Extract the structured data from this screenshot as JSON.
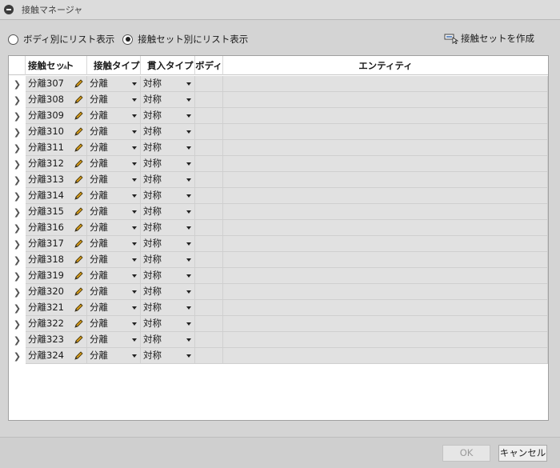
{
  "window": {
    "title": "接触マネージャ"
  },
  "mode": {
    "options": [
      {
        "label": "ボディ別にリスト表示",
        "checked": false
      },
      {
        "label": "接触セット別にリスト表示",
        "checked": true
      }
    ],
    "create_set_label": "接触セットを作成"
  },
  "grid": {
    "columns": [
      "接触セット",
      "接触タイプ",
      "貫入タイプ",
      "ボディ",
      "エンティティ"
    ],
    "rows": [
      {
        "name": "分離307",
        "contact_type": "分離",
        "penetration_type": "対称",
        "body": "",
        "entity": ""
      },
      {
        "name": "分離308",
        "contact_type": "分離",
        "penetration_type": "対称",
        "body": "",
        "entity": ""
      },
      {
        "name": "分離309",
        "contact_type": "分離",
        "penetration_type": "対称",
        "body": "",
        "entity": ""
      },
      {
        "name": "分離310",
        "contact_type": "分離",
        "penetration_type": "対称",
        "body": "",
        "entity": ""
      },
      {
        "name": "分離311",
        "contact_type": "分離",
        "penetration_type": "対称",
        "body": "",
        "entity": ""
      },
      {
        "name": "分離312",
        "contact_type": "分離",
        "penetration_type": "対称",
        "body": "",
        "entity": ""
      },
      {
        "name": "分離313",
        "contact_type": "分離",
        "penetration_type": "対称",
        "body": "",
        "entity": ""
      },
      {
        "name": "分離314",
        "contact_type": "分離",
        "penetration_type": "対称",
        "body": "",
        "entity": ""
      },
      {
        "name": "分離315",
        "contact_type": "分離",
        "penetration_type": "対称",
        "body": "",
        "entity": ""
      },
      {
        "name": "分離316",
        "contact_type": "分離",
        "penetration_type": "対称",
        "body": "",
        "entity": ""
      },
      {
        "name": "分離317",
        "contact_type": "分離",
        "penetration_type": "対称",
        "body": "",
        "entity": ""
      },
      {
        "name": "分離318",
        "contact_type": "分離",
        "penetration_type": "対称",
        "body": "",
        "entity": ""
      },
      {
        "name": "分離319",
        "contact_type": "分離",
        "penetration_type": "対称",
        "body": "",
        "entity": ""
      },
      {
        "name": "分離320",
        "contact_type": "分離",
        "penetration_type": "対称",
        "body": "",
        "entity": ""
      },
      {
        "name": "分離321",
        "contact_type": "分離",
        "penetration_type": "対称",
        "body": "",
        "entity": ""
      },
      {
        "name": "分離322",
        "contact_type": "分離",
        "penetration_type": "対称",
        "body": "",
        "entity": ""
      },
      {
        "name": "分離323",
        "contact_type": "分離",
        "penetration_type": "対称",
        "body": "",
        "entity": ""
      },
      {
        "name": "分離324",
        "contact_type": "分離",
        "penetration_type": "対称",
        "body": "",
        "entity": ""
      }
    ]
  },
  "footer": {
    "ok_label": "OK",
    "ok_enabled": false,
    "cancel_label": "キャンセル"
  },
  "colors": {
    "row_background": "#e1e1e1",
    "pencil": "#d49a1a",
    "panel": "#d4d4d4"
  }
}
